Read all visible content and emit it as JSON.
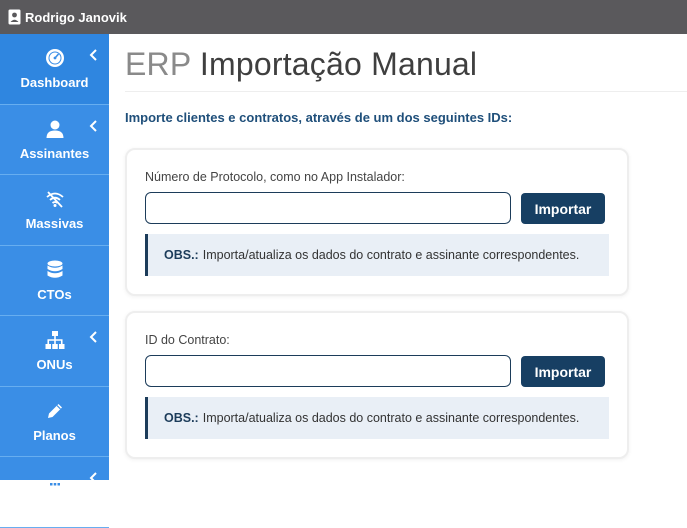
{
  "topbar": {
    "user_name": "Rodrigo Janovik"
  },
  "sidebar": {
    "items": [
      {
        "label": "Dashboard",
        "icon": "gauge-icon",
        "has_chevron": true
      },
      {
        "label": "Assinantes",
        "icon": "user-icon",
        "has_chevron": true
      },
      {
        "label": "Massivas",
        "icon": "wifi-off-icon",
        "has_chevron": false
      },
      {
        "label": "CTOs",
        "icon": "database-icon",
        "has_chevron": false
      },
      {
        "label": "ONUs",
        "icon": "sitemap-icon",
        "has_chevron": true
      },
      {
        "label": "Planos",
        "icon": "pencil-icon",
        "has_chevron": false
      },
      {
        "label": "",
        "icon": "calculator-icon",
        "has_chevron": true
      }
    ]
  },
  "main": {
    "title_prefix": "ERP",
    "title_main": "Importação Manual",
    "intro": "Importe clientes e contratos, através de um dos seguintes IDs:",
    "cards": [
      {
        "field_label": "Número de Protocolo, como no App Instalador:",
        "input_value": "",
        "button_label": "Importar",
        "obs_label": "OBS.:",
        "obs_text": "Importa/atualiza os dados do contrato e assinante correspondentes."
      },
      {
        "field_label": "ID do Contrato:",
        "input_value": "",
        "button_label": "Importar",
        "obs_label": "OBS.:",
        "obs_text": "Importa/atualiza os dados do contrato e assinante correspondentes."
      }
    ]
  },
  "colors": {
    "topbar": "#5a595c",
    "sidebar": "#3a8ee6",
    "button": "#173f63",
    "intro_text": "#1f4f7a",
    "obs_bg": "#e9eff6"
  }
}
